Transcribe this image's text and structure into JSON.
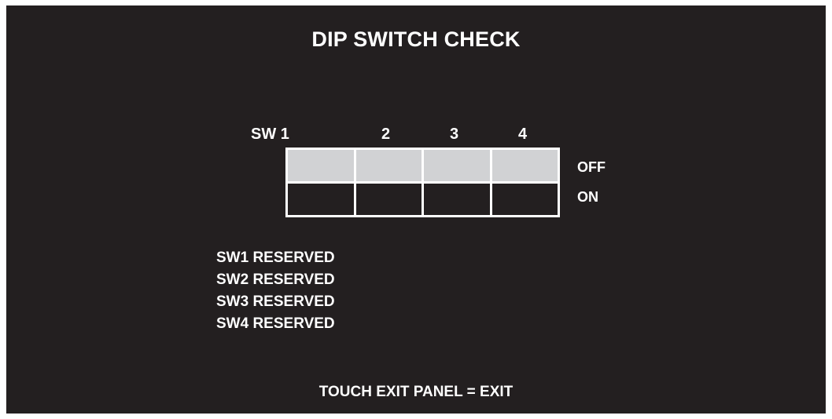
{
  "title": "DIP SWITCH CHECK",
  "switch_headers": {
    "first": "SW 1",
    "second": "2",
    "third": "3",
    "fourth": "4"
  },
  "row_labels": {
    "off": "OFF",
    "on": "ON"
  },
  "switches": [
    {
      "number": "1",
      "state": "OFF"
    },
    {
      "number": "2",
      "state": "OFF"
    },
    {
      "number": "3",
      "state": "OFF"
    },
    {
      "number": "4",
      "state": "OFF"
    }
  ],
  "reserved_list": [
    "SW1 RESERVED",
    "SW2 RESERVED",
    "SW3 RESERVED",
    "SW4 RESERVED"
  ],
  "footer": "TOUCH EXIT PANEL = EXIT",
  "colors": {
    "background": "#231f20",
    "text": "#ffffff",
    "grid_line": "#ffffff",
    "switch_indicator": "#d1d2d4"
  }
}
